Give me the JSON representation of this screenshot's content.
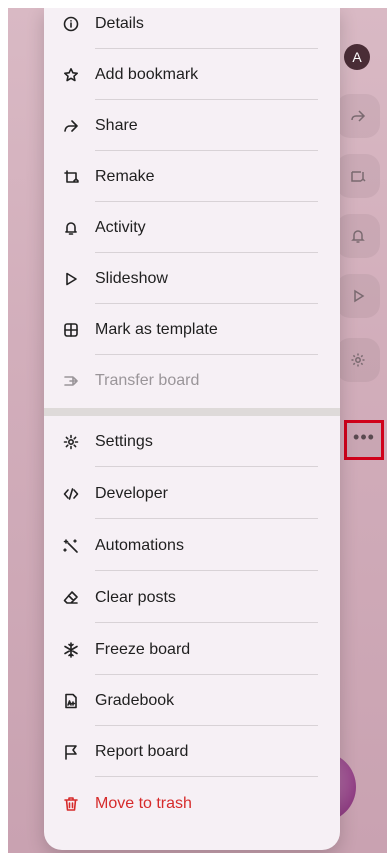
{
  "avatar": {
    "initial": "A"
  },
  "more_button": {
    "glyph": "•••"
  },
  "menu": {
    "items": [
      {
        "label": "Details",
        "icon": "info-icon"
      },
      {
        "label": "Add bookmark",
        "icon": "star-icon"
      },
      {
        "label": "Share",
        "icon": "share-arrow-icon"
      },
      {
        "label": "Remake",
        "icon": "remake-icon"
      },
      {
        "label": "Activity",
        "icon": "bell-icon"
      },
      {
        "label": "Slideshow",
        "icon": "play-icon"
      },
      {
        "label": "Mark as template",
        "icon": "template-icon"
      },
      {
        "label": "Transfer board",
        "icon": "transfer-icon",
        "disabled": true
      },
      {
        "label": "Settings",
        "icon": "gear-icon"
      },
      {
        "label": "Developer",
        "icon": "code-icon"
      },
      {
        "label": "Automations",
        "icon": "magic-wand-icon"
      },
      {
        "label": "Clear posts",
        "icon": "eraser-icon"
      },
      {
        "label": "Freeze board",
        "icon": "snowflake-icon"
      },
      {
        "label": "Gradebook",
        "icon": "gradebook-icon"
      },
      {
        "label": "Report board",
        "icon": "flag-icon"
      },
      {
        "label": "Move to trash",
        "icon": "trash-icon",
        "danger": true
      }
    ]
  },
  "colors": {
    "danger": "#d62b2b",
    "highlight": "#d0021b",
    "menu_bg": "#f6f0f5",
    "avatar_bg": "#4a2d36"
  }
}
